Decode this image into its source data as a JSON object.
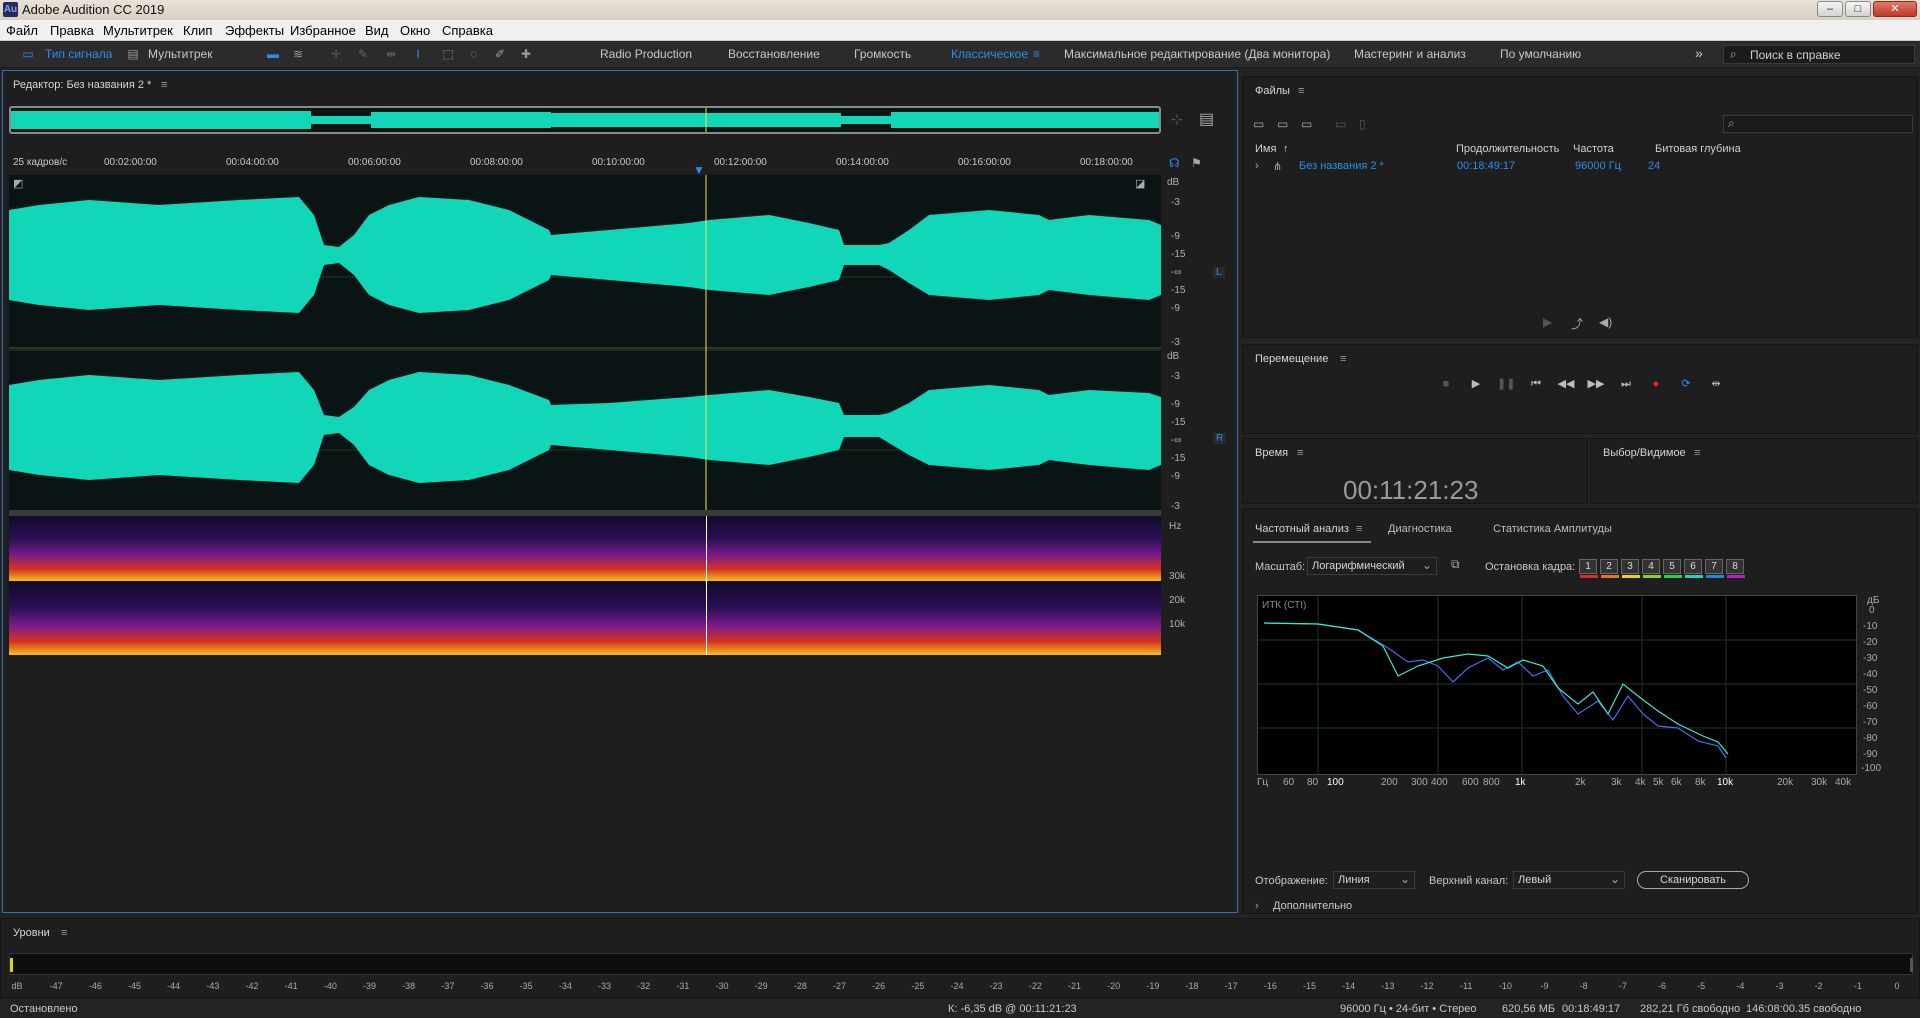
{
  "window": {
    "title": "Adobe Audition CC 2019",
    "app_icon": "Au",
    "minimize": "–",
    "maximize": "□",
    "close": "✕"
  },
  "menu": [
    "Файл",
    "Правка",
    "Мультитрек",
    "Клип",
    "Эффекты",
    "Избранное",
    "Вид",
    "Окно",
    "Справка"
  ],
  "toolbar": {
    "waveform_label": "Тип сигнала",
    "multitrack_label": "Мультитрек",
    "workspaces": [
      "Radio Production",
      "Восстановление",
      "Громкость",
      "Классическое",
      "Максимальное редактирование (Два монитора)",
      "Мастеринг и анализ",
      "По умолчанию"
    ],
    "active_workspace": "Классическое",
    "overflow": "»",
    "search_placeholder": "Поиск в справке"
  },
  "editor": {
    "title": "Редактор: Без названия 2 *",
    "timecode_format": "25 кадров/с",
    "ruler": [
      "00:02:00:00",
      "00:04:00:00",
      "00:06:00:00",
      "00:08:00:00",
      "00:10:00:00",
      "00:12:00:00",
      "00:14:00:00",
      "00:16:00:00",
      "00:18:00:00"
    ],
    "db_unit": "dB",
    "db_labels": [
      "-3",
      "-9",
      "-15",
      "-∞",
      "-15",
      "-9",
      "-3"
    ],
    "channel_top": "L",
    "channel_bottom": "R",
    "hz_unit": "Hz",
    "hz_labels": [
      "30k",
      "20k",
      "10k"
    ],
    "playhead_fraction": 0.605
  },
  "files": {
    "title": "Файлы",
    "search_placeholder": "",
    "columns": [
      "Имя",
      "Продолжительность",
      "Частота",
      "Битовая глубина"
    ],
    "rows": [
      {
        "name": "Без названия 2 *",
        "duration": "00:18:49:17",
        "rate": "96000 Гц",
        "depth": "24"
      }
    ]
  },
  "transport": {
    "title": "Перемещение"
  },
  "time": {
    "title": "Время",
    "value": "00:11:21:23"
  },
  "selection": {
    "title": "Выбор/Видимое"
  },
  "analysis": {
    "tabs": [
      "Частотный анализ",
      "Диагностика",
      "Статистика Амплитуды"
    ],
    "scale_label": "Масштаб:",
    "scale_value": "Логарифмический",
    "freeze_label": "Остановка кадра:",
    "freeze_slots": [
      "1",
      "2",
      "3",
      "4",
      "5",
      "6",
      "7",
      "8"
    ],
    "freeze_colors": [
      "#d42b2b",
      "#e8731f",
      "#e8d41f",
      "#8ad41f",
      "#1fd44f",
      "#1fd4c4",
      "#1f8ad4",
      "#b41fd4"
    ],
    "graph_label": "ИТК (СТI)",
    "db_unit": "дБ",
    "y_ticks": [
      "0",
      "-10",
      "-20",
      "-30",
      "-40",
      "-50",
      "-60",
      "-70",
      "-80",
      "-90",
      "-100"
    ],
    "x_unit": "Гц",
    "x_ticks": [
      "60",
      "80",
      "100",
      "200",
      "300",
      "400",
      "600",
      "800",
      "1k",
      "2k",
      "3k",
      "4k",
      "5k",
      "6k",
      "8k",
      "10k",
      "20k",
      "30k",
      "40k"
    ],
    "display_label": "Отображение:",
    "display_value": "Линия",
    "channel_label": "Верхний канал:",
    "channel_value": "Левый",
    "scan_button": "Сканировать",
    "more": "Дополнительно"
  },
  "levels": {
    "title": "Уровни",
    "scale": [
      "dB",
      "-47",
      "-46",
      "-45",
      "-44",
      "-43",
      "-42",
      "-41",
      "-40",
      "-39",
      "-38",
      "-37",
      "-36",
      "-35",
      "-34",
      "-33",
      "-32",
      "-31",
      "-30",
      "-29",
      "-28",
      "-27",
      "-26",
      "-25",
      "-24",
      "-23",
      "-22",
      "-21",
      "-20",
      "-19",
      "-18",
      "-17",
      "-16",
      "-15",
      "-14",
      "-13",
      "-12",
      "-11",
      "-10",
      "-9",
      "-8",
      "-7",
      "-6",
      "-5",
      "-4",
      "-3",
      "-2",
      "-1",
      "0"
    ]
  },
  "status": {
    "state": "Остановлено",
    "cursor": "К: -6,35 dB @ 00:11:21:23",
    "format": "96000 Гц • 24-бит • Стерео",
    "size": "620,56 МБ",
    "duration": "00:18:49:17",
    "free": "282,21 Гб свободно",
    "free_time": "146:08:00.35 свободно"
  },
  "colors": {
    "waveform": "#12d6b8",
    "accent": "#2d8ceb",
    "playhead": "#e8e85a"
  }
}
